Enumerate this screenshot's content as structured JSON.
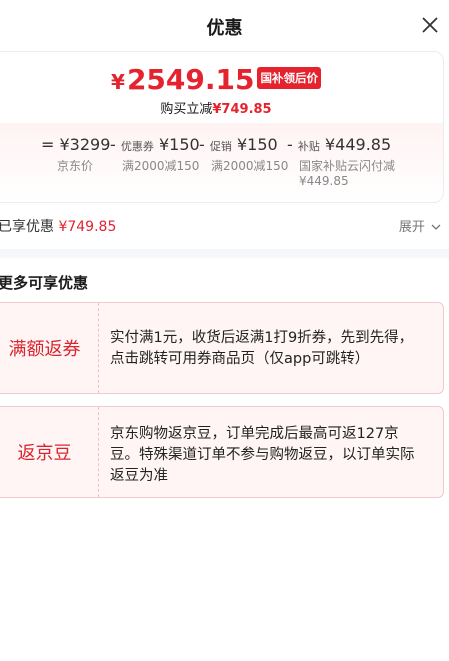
{
  "header": {
    "title": "优惠"
  },
  "summary": {
    "final_price": "2549.15",
    "currency_symbol": "¥",
    "tag": "国补领后价",
    "save_label": "购买立减",
    "save_amount": "¥749.85"
  },
  "breakdown": {
    "items": [
      {
        "prefix": "=",
        "label": "",
        "value": "¥3299",
        "sub": "京东价"
      },
      {
        "prefix": "-",
        "label": "优惠券",
        "value": "¥150",
        "sub": "满2000减150"
      },
      {
        "prefix": "-",
        "label": "促销",
        "value": "¥150",
        "sub": "满2000减150"
      },
      {
        "prefix": "-",
        "label": "补贴",
        "value": "¥449.85",
        "sub": "国家补贴云闪付减¥449.85"
      }
    ]
  },
  "enjoyed": {
    "label": "已享优惠",
    "amount": "¥749.85"
  },
  "expand_label": "展开",
  "more": {
    "title": "更多可享优惠",
    "items": [
      {
        "name": "满额返券",
        "desc": "实付满1元，收货后返满1打9折券，先到先得，点击跳转可用券商品页（仅app可跳转）"
      },
      {
        "name": "返京豆",
        "desc": "京东购物返京豆，订单完成后最高可返127京豆。特殊渠道订单不参与购物返豆，以订单实际返豆为准"
      }
    ]
  },
  "colors": {
    "accent": "#e4232f"
  }
}
